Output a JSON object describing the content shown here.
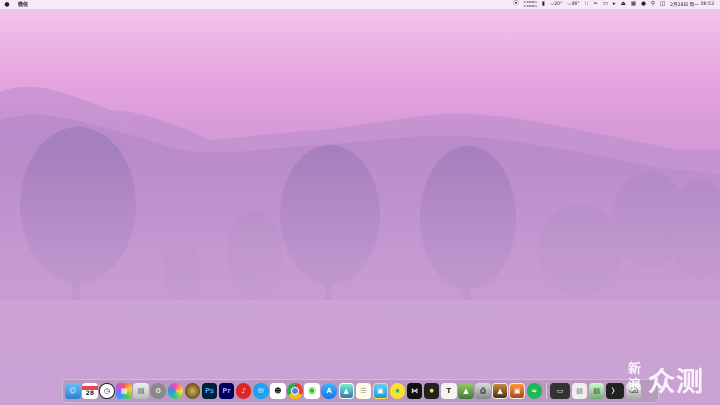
{
  "menubar": {
    "app_name": "微信",
    "net_up": "0.16KB/s",
    "net_down": "0.26KB/s",
    "temp1": "20°",
    "temp2": "46°",
    "date": "2月28日 周一",
    "time": "06:53"
  },
  "dock": {
    "calendar_day": "28",
    "ps_label": "Ps",
    "pr_label": "Pr",
    "text_label": "T",
    "icons": [
      "finder",
      "calendar",
      "clock",
      "launchpad",
      "preview",
      "system-preferences",
      "color-app",
      "black-app",
      "photoshop",
      "premiere",
      "netease-music",
      "message",
      "qq",
      "chrome",
      "wechat",
      "app-store",
      "photo-viewer",
      "notes",
      "screenshot",
      "yellow-app",
      "capcut",
      "rec-app",
      "text-edit",
      "photos-green",
      "printer",
      "photo-gallery",
      "images",
      "spotify",
      "monitor",
      "terminal",
      "trash"
    ]
  },
  "watermark": {
    "line1": "新",
    "line2": "浪",
    "brand": "众测"
  }
}
